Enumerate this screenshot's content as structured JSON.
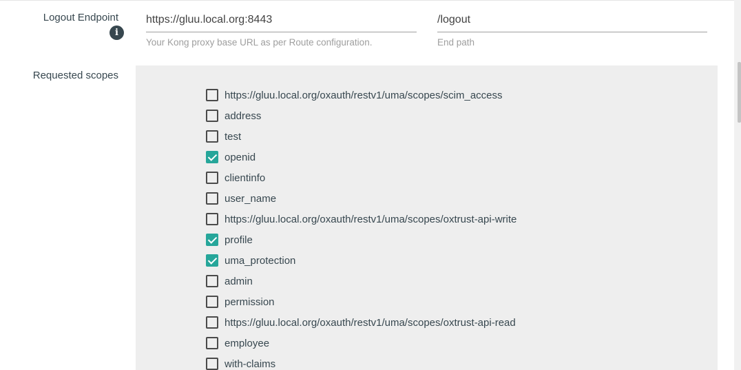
{
  "logout": {
    "label": "Logout Endpoint",
    "info_icon": "info-icon",
    "base_url": {
      "value": "https://gluu.local.org:8443",
      "helper": "Your Kong proxy base URL as per Route configuration."
    },
    "path": {
      "value": "/logout",
      "helper": "End path"
    }
  },
  "scopes": {
    "label": "Requested scopes",
    "accent_color": "#26a69a",
    "items": [
      {
        "label": "https://gluu.local.org/oxauth/restv1/uma/scopes/scim_access",
        "checked": false
      },
      {
        "label": "address",
        "checked": false
      },
      {
        "label": "test",
        "checked": false
      },
      {
        "label": "openid",
        "checked": true
      },
      {
        "label": "clientinfo",
        "checked": false
      },
      {
        "label": "user_name",
        "checked": false
      },
      {
        "label": "https://gluu.local.org/oxauth/restv1/uma/scopes/oxtrust-api-write",
        "checked": false
      },
      {
        "label": "profile",
        "checked": true
      },
      {
        "label": "uma_protection",
        "checked": true
      },
      {
        "label": "admin",
        "checked": false
      },
      {
        "label": "permission",
        "checked": false
      },
      {
        "label": "https://gluu.local.org/oxauth/restv1/uma/scopes/oxtrust-api-read",
        "checked": false
      },
      {
        "label": "employee",
        "checked": false
      },
      {
        "label": "with-claims",
        "checked": false
      }
    ]
  }
}
